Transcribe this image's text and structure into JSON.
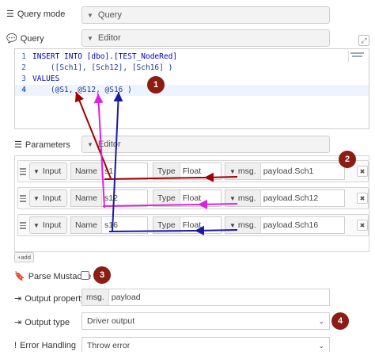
{
  "query_mode": {
    "label": "Query mode",
    "value": "Query"
  },
  "query": {
    "label": "Query",
    "editor_value": "Editor"
  },
  "code_lines": [
    {
      "num": "1",
      "text": "INSERT INTO [dbo].[TEST_NodeRed]"
    },
    {
      "num": "2",
      "text": "    ([Sch1], [Sch12], [Sch16] )"
    },
    {
      "num": "3",
      "text": "VALUES"
    },
    {
      "num": "4",
      "text": "    (@S1, @S12, @S16 )"
    }
  ],
  "parameters": {
    "label": "Parameters",
    "editor_value": "Editor",
    "rows": [
      {
        "direction": "Input",
        "name_label": "Name",
        "name": "s1",
        "type_label": "Type",
        "type": "Float",
        "source": "msg.",
        "value": "payload.Sch1"
      },
      {
        "direction": "Input",
        "name_label": "Name",
        "name": "s12",
        "type_label": "Type",
        "type": "Float",
        "source": "msg.",
        "value": "payload.Sch12"
      },
      {
        "direction": "Input",
        "name_label": "Name",
        "name": "s16",
        "type_label": "Type",
        "type": "Float",
        "source": "msg.",
        "value": "payload.Sch16"
      }
    ],
    "add_label": "add"
  },
  "parse_mustache": {
    "label": "Parse Mustache"
  },
  "output_property": {
    "label": "Output property",
    "prefix": "msg.",
    "value": "payload"
  },
  "output_type": {
    "label": "Output type",
    "value": "Driver output"
  },
  "error_handling": {
    "label": "Error Handling",
    "value": "Throw error"
  },
  "badges": [
    "1",
    "2",
    "3",
    "4"
  ],
  "annotation_colors": {
    "red": "#a00000",
    "magenta": "#e020e0",
    "blue": "#1a1aa0",
    "badge": "#8b1d14"
  }
}
